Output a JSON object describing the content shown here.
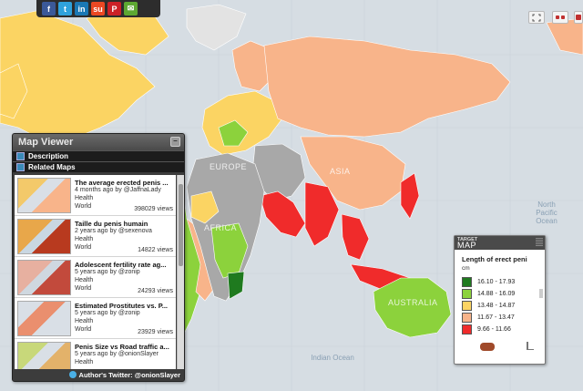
{
  "share": {
    "buttons": [
      {
        "icon": "facebook-icon",
        "glyph": "f",
        "color": "#3b5998"
      },
      {
        "icon": "twitter-icon",
        "glyph": "t",
        "color": "#2fa2dc"
      },
      {
        "icon": "linkedin-icon",
        "glyph": "in",
        "color": "#1a78b4"
      },
      {
        "icon": "stumbleupon-icon",
        "glyph": "su",
        "color": "#eb4823"
      },
      {
        "icon": "pinterest-icon",
        "glyph": "P",
        "color": "#cb2027"
      },
      {
        "icon": "email-icon",
        "glyph": "✉",
        "color": "#5da832"
      }
    ]
  },
  "controls": {
    "fullscreen_icon": "fullscreen-icon",
    "glasses_icon": "glasses-icon",
    "extra_icon": "brand-icon"
  },
  "map_labels": {
    "north_pacific": "North\nPacific\nOcean",
    "indian": "Indian Ocean",
    "australia": "AUSTRALIA",
    "asia": "ASIA",
    "africa": "AFRICA",
    "europe": "EUROPE"
  },
  "viewer": {
    "title": "Map Viewer",
    "tab_description": "Description",
    "tab_related": "Related Maps",
    "items": [
      {
        "title": "The average erected penis ...",
        "meta": "4 months ago by @JaffnaLady",
        "category": "Health",
        "region": "World",
        "views": "398029 views"
      },
      {
        "title": "Taille du penis humain",
        "meta": "2 years ago by @sexenova",
        "category": "Health",
        "region": "World",
        "views": "14822 views"
      },
      {
        "title": "Adolescent fertility rate ag...",
        "meta": "5 years ago by @zonip",
        "category": "Health",
        "region": "World",
        "views": "24293 views"
      },
      {
        "title": "Estimated Prostitutes vs. P...",
        "meta": "5 years ago by @zonip",
        "category": "Health",
        "region": "World",
        "views": "23929 views"
      },
      {
        "title": "Penis Size vs Road traffic a...",
        "meta": "5 years ago by @onionSlayer",
        "category": "Health",
        "region": "",
        "views": ""
      }
    ],
    "footer": "Author's Twitter: @onionSlayer"
  },
  "legend": {
    "brand_top": "TARGET",
    "brand": "MAP",
    "title": "Length of erect peni",
    "unit": "cm",
    "ranges": [
      {
        "label": "16.10 - 17.93",
        "color": "#1f7a1f"
      },
      {
        "label": "14.88 - 16.09",
        "color": "#8cd23c"
      },
      {
        "label": "13.48 - 14.87",
        "color": "#fbd463"
      },
      {
        "label": "11.67 - 13.47",
        "color": "#f8b48a"
      },
      {
        "label": "9.66 - 11.66",
        "color": "#f02b2b"
      }
    ]
  }
}
